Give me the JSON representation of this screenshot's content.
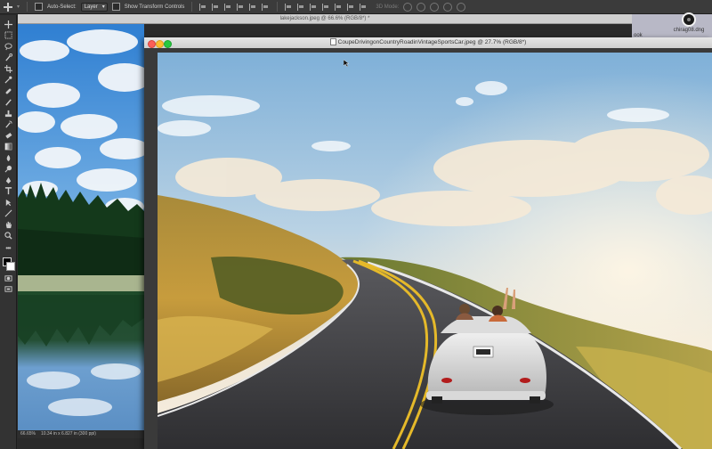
{
  "options_bar": {
    "auto_select_label": "Auto-Select:",
    "layer_select_value": "Layer",
    "show_transform_label": "Show Transform Controls",
    "mode_3d_label": "3D Mode:"
  },
  "tools": [
    "move-tool",
    "marquee-tool",
    "lasso-tool",
    "quick-select-tool",
    "crop-tool",
    "eyedropper-tool",
    "healing-brush-tool",
    "brush-tool",
    "clone-stamp-tool",
    "history-brush-tool",
    "eraser-tool",
    "gradient-tool",
    "blur-tool",
    "dodge-tool",
    "pen-tool",
    "type-tool",
    "path-selection-tool",
    "line-tool",
    "hand-tool",
    "zoom-tool"
  ],
  "doc_back": {
    "title": "lakejackson.jpeg @ 66.6% (RGB/8*) *",
    "zoom": "66.65%",
    "info": "10.34 in x 6.827 in (300 ppi)"
  },
  "doc_front": {
    "title": "CoupeDrivingonCountryRoadinVintageSportsCar.jpeg @ 27.7% (RGB/8*)"
  },
  "desktop": {
    "file_label": "chirag08.dng",
    "partial_label": "ook"
  },
  "colors": {
    "foreground": "#000000",
    "background": "#ffffff",
    "sky": "#7fb6e0",
    "road": "#3a3a3c",
    "road_line": "#e5b92a"
  }
}
